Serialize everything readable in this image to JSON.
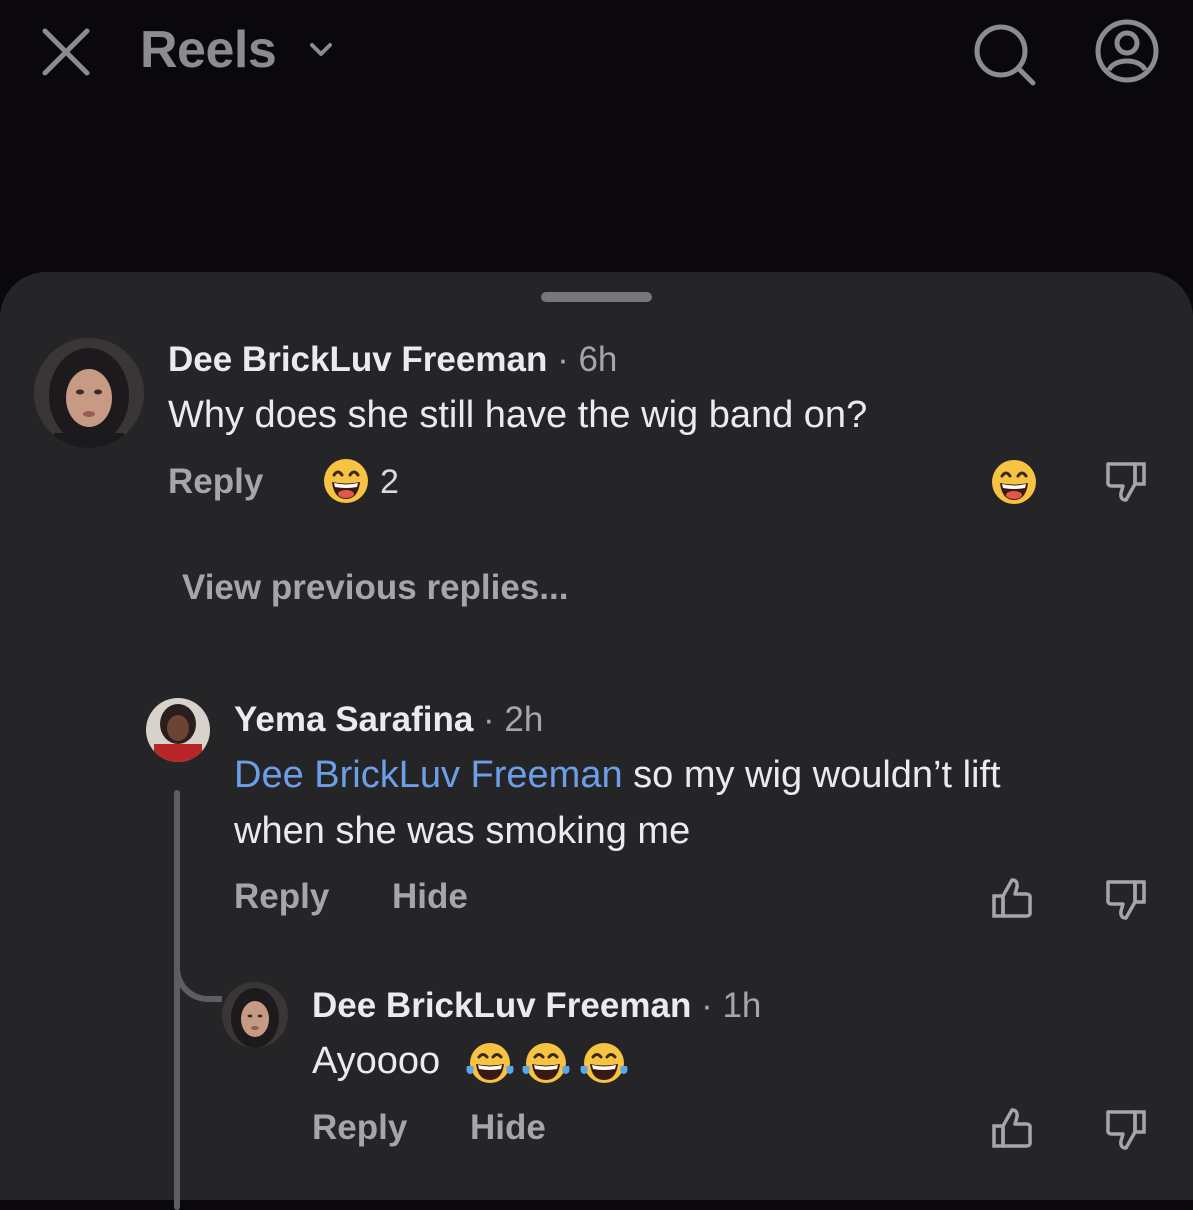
{
  "header": {
    "title": "Reels"
  },
  "comments": [
    {
      "author": "Dee BrickLuv Freeman",
      "time": "· 6h",
      "text": "Why does she still have the wig band on?",
      "reply_label": "Reply",
      "reaction_count": "2"
    }
  ],
  "view_previous_label": "View previous replies...",
  "replies": [
    {
      "author": "Yema Sarafina",
      "time": "· 2h",
      "mention": "Dee BrickLuv Freeman",
      "text_line1": " so my wig wouldn’t lift",
      "text_line2": "when she was smoking me",
      "reply_label": "Reply",
      "hide_label": "Hide"
    },
    {
      "author": "Dee BrickLuv Freeman",
      "time": "· 1h",
      "text": "Ayoooo",
      "reply_label": "Reply",
      "hide_label": "Hide"
    }
  ],
  "colors": {
    "background": "#0b080d",
    "sheet": "#252528",
    "mention": "#6d9ee8",
    "muted": "#a6a6aa",
    "emoji": "#f6c343"
  },
  "icons": [
    "close-icon",
    "chevron-down-icon",
    "search-icon",
    "profile-icon",
    "grin-emoji-icon",
    "thumbs-down-icon",
    "thumbs-up-icon",
    "laugh-cry-emoji-icon"
  ]
}
